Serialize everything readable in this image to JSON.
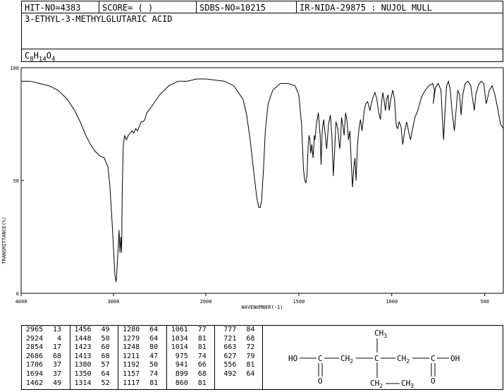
{
  "header": {
    "hit_no": "HIT-NO=4383",
    "score": "SCORE=  (   )",
    "sdbs_no": "SDBS-NO=10215",
    "ir_code": "IR-NIDA-29875 : NUJOL MULL"
  },
  "compound": {
    "name": "3-ETHYL-3-METHYLGLUTARIC ACID",
    "formula_prefix": "C",
    "formula_c": "8",
    "formula_h_letter": "H",
    "formula_h": "14",
    "formula_o_letter": "O",
    "formula_o": "4"
  },
  "chart_data": {
    "type": "line",
    "xlabel": "WAVENUMBER(-1)",
    "ylabel": "TRANSMITTANCE(%)",
    "xlim": [
      4000,
      400
    ],
    "ylim": [
      0,
      100
    ],
    "x_ticks": [
      4000,
      3000,
      2000,
      1500,
      1000,
      500
    ],
    "y_ticks": [
      0,
      50,
      100
    ],
    "grid": false,
    "series": [
      {
        "points": [
          [
            4000,
            94
          ],
          [
            3900,
            94
          ],
          [
            3800,
            93
          ],
          [
            3700,
            92
          ],
          [
            3600,
            90
          ],
          [
            3500,
            86
          ],
          [
            3420,
            81
          ],
          [
            3350,
            75
          ],
          [
            3300,
            70
          ],
          [
            3250,
            66
          ],
          [
            3200,
            63
          ],
          [
            3150,
            61
          ],
          [
            3100,
            60
          ],
          [
            3060,
            56
          ],
          [
            3040,
            48
          ],
          [
            3020,
            35
          ],
          [
            3000,
            20
          ],
          [
            2985,
            8
          ],
          [
            2970,
            5
          ],
          [
            2960,
            12
          ],
          [
            2950,
            20
          ],
          [
            2940,
            28
          ],
          [
            2930,
            18
          ],
          [
            2920,
            25
          ],
          [
            2912,
            18
          ],
          [
            2905,
            45
          ],
          [
            2895,
            65
          ],
          [
            2880,
            70
          ],
          [
            2860,
            68
          ],
          [
            2840,
            70
          ],
          [
            2820,
            71
          ],
          [
            2800,
            72
          ],
          [
            2780,
            71
          ],
          [
            2760,
            73
          ],
          [
            2740,
            72
          ],
          [
            2720,
            74
          ],
          [
            2700,
            76
          ],
          [
            2680,
            76
          ],
          [
            2660,
            77
          ],
          [
            2640,
            80
          ],
          [
            2600,
            82
          ],
          [
            2550,
            85
          ],
          [
            2500,
            88
          ],
          [
            2450,
            90
          ],
          [
            2400,
            92
          ],
          [
            2350,
            93
          ],
          [
            2300,
            94
          ],
          [
            2200,
            94
          ],
          [
            2100,
            95
          ],
          [
            2000,
            95
          ],
          [
            1900,
            94
          ],
          [
            1850,
            92
          ],
          [
            1800,
            86
          ],
          [
            1780,
            79
          ],
          [
            1760,
            67
          ],
          [
            1740,
            52
          ],
          [
            1725,
            42
          ],
          [
            1715,
            38
          ],
          [
            1708,
            38
          ],
          [
            1700,
            41
          ],
          [
            1690,
            55
          ],
          [
            1680,
            72
          ],
          [
            1665,
            84
          ],
          [
            1640,
            90
          ],
          [
            1600,
            93
          ],
          [
            1560,
            93
          ],
          [
            1520,
            92
          ],
          [
            1500,
            88
          ],
          [
            1485,
            75
          ],
          [
            1475,
            55
          ],
          [
            1468,
            50
          ],
          [
            1462,
            49
          ],
          [
            1456,
            52
          ],
          [
            1450,
            65
          ],
          [
            1445,
            70
          ],
          [
            1440,
            68
          ],
          [
            1436,
            62
          ],
          [
            1430,
            66
          ],
          [
            1423,
            60
          ],
          [
            1416,
            70
          ],
          [
            1413,
            68
          ],
          [
            1405,
            75
          ],
          [
            1395,
            80
          ],
          [
            1385,
            70
          ],
          [
            1380,
            57
          ],
          [
            1374,
            72
          ],
          [
            1366,
            77
          ],
          [
            1360,
            72
          ],
          [
            1350,
            64
          ],
          [
            1340,
            75
          ],
          [
            1330,
            79
          ],
          [
            1322,
            70
          ],
          [
            1314,
            52
          ],
          [
            1306,
            65
          ],
          [
            1300,
            76
          ],
          [
            1290,
            73
          ],
          [
            1280,
            64
          ],
          [
            1275,
            68
          ],
          [
            1270,
            78
          ],
          [
            1262,
            74
          ],
          [
            1256,
            70
          ],
          [
            1248,
            80
          ],
          [
            1240,
            76
          ],
          [
            1233,
            68
          ],
          [
            1225,
            72
          ],
          [
            1218,
            58
          ],
          [
            1211,
            47
          ],
          [
            1205,
            55
          ],
          [
            1198,
            60
          ],
          [
            1192,
            50
          ],
          [
            1184,
            66
          ],
          [
            1176,
            73
          ],
          [
            1168,
            77
          ],
          [
            1160,
            72
          ],
          [
            1157,
            74
          ],
          [
            1148,
            81
          ],
          [
            1140,
            84
          ],
          [
            1130,
            85
          ],
          [
            1117,
            81
          ],
          [
            1110,
            84
          ],
          [
            1100,
            87
          ],
          [
            1090,
            89
          ],
          [
            1080,
            86
          ],
          [
            1070,
            80
          ],
          [
            1061,
            77
          ],
          [
            1054,
            85
          ],
          [
            1048,
            89
          ],
          [
            1042,
            86
          ],
          [
            1034,
            81
          ],
          [
            1028,
            86
          ],
          [
            1020,
            88
          ],
          [
            1014,
            81
          ],
          [
            1005,
            86
          ],
          [
            995,
            90
          ],
          [
            985,
            86
          ],
          [
            975,
            74
          ],
          [
            968,
            73
          ],
          [
            960,
            76
          ],
          [
            950,
            74
          ],
          [
            941,
            66
          ],
          [
            930,
            72
          ],
          [
            920,
            76
          ],
          [
            910,
            72
          ],
          [
            899,
            68
          ],
          [
            890,
            72
          ],
          [
            875,
            78
          ],
          [
            860,
            81
          ],
          [
            850,
            84
          ],
          [
            840,
            87
          ],
          [
            820,
            90
          ],
          [
            800,
            92
          ],
          [
            780,
            93
          ],
          [
            770,
            90
          ],
          [
            777,
            84
          ],
          [
            765,
            91
          ],
          [
            750,
            93
          ],
          [
            735,
            90
          ],
          [
            728,
            78
          ],
          [
            721,
            68
          ],
          [
            714,
            80
          ],
          [
            705,
            92
          ],
          [
            695,
            94
          ],
          [
            685,
            90
          ],
          [
            675,
            80
          ],
          [
            663,
            72
          ],
          [
            655,
            80
          ],
          [
            645,
            90
          ],
          [
            635,
            88
          ],
          [
            627,
            79
          ],
          [
            618,
            88
          ],
          [
            605,
            93
          ],
          [
            590,
            94
          ],
          [
            575,
            92
          ],
          [
            565,
            86
          ],
          [
            556,
            81
          ],
          [
            548,
            88
          ],
          [
            535,
            92
          ],
          [
            520,
            94
          ],
          [
            505,
            93
          ],
          [
            498,
            88
          ],
          [
            492,
            84
          ],
          [
            486,
            86
          ],
          [
            475,
            90
          ],
          [
            460,
            92
          ],
          [
            445,
            88
          ],
          [
            430,
            82
          ],
          [
            415,
            75
          ],
          [
            400,
            73
          ]
        ]
      }
    ],
    "peaks": [
      [
        [
          "2965",
          "13"
        ],
        [
          "2924",
          "4"
        ],
        [
          "2854",
          "17"
        ],
        [
          "2686",
          "68"
        ],
        [
          "1706",
          "37"
        ],
        [
          "1694",
          "37"
        ],
        [
          "1462",
          "49"
        ]
      ],
      [
        [
          "1456",
          "49"
        ],
        [
          "1448",
          "50"
        ],
        [
          "1423",
          "60"
        ],
        [
          "1413",
          "68"
        ],
        [
          "1380",
          "57"
        ],
        [
          "1350",
          "64"
        ],
        [
          "1314",
          "52"
        ]
      ],
      [
        [
          "1280",
          "64"
        ],
        [
          "1279",
          "64"
        ],
        [
          "1248",
          "80"
        ],
        [
          "1211",
          "47"
        ],
        [
          "1192",
          "50"
        ],
        [
          "1157",
          "74"
        ],
        [
          "1117",
          "81"
        ]
      ],
      [
        [
          "1061",
          "77"
        ],
        [
          "1034",
          "81"
        ],
        [
          "1014",
          "81"
        ],
        [
          "975",
          "74"
        ],
        [
          "941",
          "66"
        ],
        [
          "899",
          "68"
        ],
        [
          "860",
          "81"
        ]
      ],
      [
        [
          "777",
          "84"
        ],
        [
          "721",
          "68"
        ],
        [
          "663",
          "72"
        ],
        [
          "627",
          "79"
        ],
        [
          "556",
          "81"
        ],
        [
          "492",
          "64"
        ]
      ]
    ]
  },
  "structure": {
    "ch3_top": "CH",
    "ch3_top_sub": "3",
    "ho": "HO",
    "c1": "C",
    "ch2_left": "CH",
    "ch2_left_sub": "2",
    "c_center": "C",
    "ch2_right": "CH",
    "ch2_right_sub": "2",
    "c2": "C",
    "oh": "OH",
    "o_left": "O",
    "o_right": "O",
    "ch2_bottom": "CH",
    "ch2_bottom_sub": "2",
    "ch3_bottom": "CH",
    "ch3_bottom_sub": "3"
  }
}
